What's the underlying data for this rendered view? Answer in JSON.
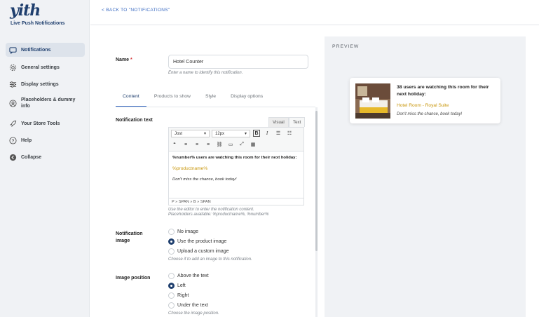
{
  "app": {
    "logo": "yith",
    "product": "Live Push Notifications"
  },
  "sidebar": {
    "items": [
      {
        "label": "Notifications",
        "icon": "chat-icon",
        "active": true
      },
      {
        "label": "General settings",
        "icon": "gear-icon"
      },
      {
        "label": "Display settings",
        "icon": "sliders-icon"
      },
      {
        "label": "Placeholders & dummy info",
        "icon": "user-icon"
      },
      {
        "label": "Your Store Tools",
        "icon": "rocket-icon"
      },
      {
        "label": "Help",
        "icon": "question-icon"
      },
      {
        "label": "Collapse",
        "icon": "collapse-icon"
      }
    ]
  },
  "header": {
    "back_label": "< BACK TO \"NOTIFICATIONS\""
  },
  "form": {
    "name": {
      "label": "Name",
      "required": "*",
      "value": "Hotel Counter",
      "hint": "Enter a name to identify this notification."
    },
    "tabs": [
      "Content",
      "Products to show",
      "Style",
      "Display options"
    ],
    "notification_text": {
      "label": "Notification text",
      "editor_tabs": [
        "Visual",
        "Text"
      ],
      "font": "Jost",
      "size": "12px",
      "line1": "%number% users are watching this room for their next holiday:",
      "line2": "%productname%",
      "line3": "Don't miss the chance, book today!",
      "path": "P » SPAN » B » SPAN",
      "hint1": "Use the editor to enter the notification content.",
      "hint2": "Placeholders available: %productname%, %number%"
    },
    "image": {
      "label_line1": "Notification",
      "label_line2": "image",
      "options": [
        "No image",
        "Use the product image",
        "Upload a custom image"
      ],
      "selected": 1,
      "hint": "Choose if to add an image to this notification."
    },
    "position": {
      "label": "Image position",
      "options": [
        "Above the text",
        "Left",
        "Right",
        "Under the text"
      ],
      "selected": 1,
      "hint": "Choose the image position."
    }
  },
  "preview": {
    "title": "PREVIEW",
    "text": "38 users are watching this room for their next holiday:",
    "product": "Hotel Room - Royal Suite",
    "cta": "Don't miss the chance, book today!"
  },
  "colors": {
    "accent": "#1f3f6e",
    "link": "#3b6bc2",
    "product": "#c8960a"
  }
}
